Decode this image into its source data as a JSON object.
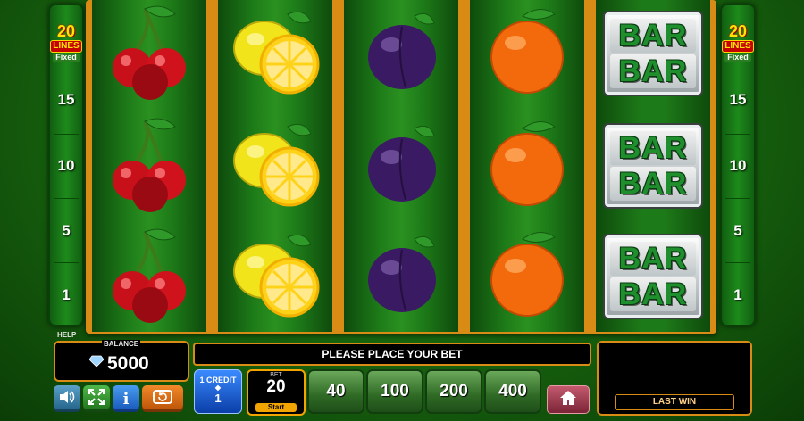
{
  "lines_panel": {
    "count": "20",
    "word": "LINES",
    "fixed": "Fixed",
    "numbers": [
      "15",
      "10",
      "5",
      "1"
    ]
  },
  "reels": [
    {
      "symbol": "cherry",
      "icon": "cherry-icon"
    },
    {
      "symbol": "lemon",
      "icon": "lemon-icon"
    },
    {
      "symbol": "plum",
      "icon": "plum-icon"
    },
    {
      "symbol": "orange",
      "icon": "orange-icon"
    },
    {
      "symbol": "bar",
      "icon": "bar-symbol",
      "text_top": "BAR",
      "text_bottom": "BAR"
    }
  ],
  "bottom": {
    "help_label": "HELP",
    "balance_label": "BALANCE",
    "balance_value": "5000",
    "message": "PLEASE PLACE YOUR BET",
    "credit_label": "1 CREDIT",
    "credit_value": "1",
    "bet_label": "BET",
    "bet_value": "20",
    "start_label": "Start",
    "bet_options": [
      "40",
      "100",
      "200",
      "400"
    ],
    "last_win_label": "LAST WIN"
  },
  "colors": {
    "frame": "#d98c15",
    "bar_text": "#1f8f2e",
    "credit_button": "#1f5fd6"
  }
}
